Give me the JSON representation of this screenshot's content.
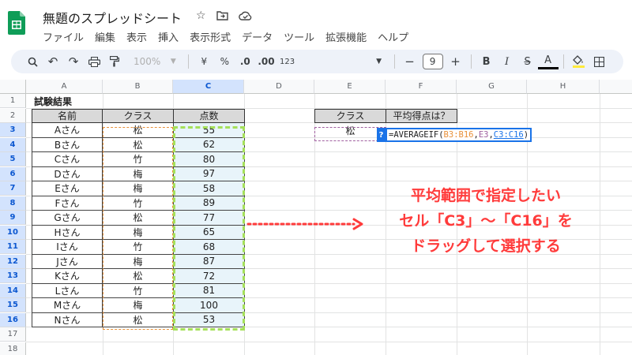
{
  "title_bar": {
    "doc_title": "無題のスプレッドシート",
    "menu": [
      "ファイル",
      "編集",
      "表示",
      "挿入",
      "表示形式",
      "データ",
      "ツール",
      "拡張機能",
      "ヘルプ"
    ]
  },
  "toolbar": {
    "zoom": "100%",
    "currency": "¥",
    "percent": "%",
    "decimal_decrease": ".0",
    "decimal_increase": ".00",
    "number_format": "123",
    "font_size": "9",
    "minus": "−",
    "plus": "+",
    "bold": "B",
    "italic": "I",
    "strike": "S",
    "text_color": "A"
  },
  "columns": [
    "A",
    "B",
    "C",
    "D",
    "E",
    "F",
    "G",
    "H"
  ],
  "rows": [
    "1",
    "2",
    "3",
    "4",
    "5",
    "6",
    "7",
    "8",
    "9",
    "10",
    "11",
    "12",
    "13",
    "14",
    "15",
    "16",
    "17",
    "18"
  ],
  "sheet": {
    "title": "試験結果",
    "headers": {
      "name": "名前",
      "class": "クラス",
      "score": "点数"
    },
    "records": [
      {
        "name": "Aさん",
        "class": "松",
        "score": "55"
      },
      {
        "name": "Bさん",
        "class": "松",
        "score": "62"
      },
      {
        "name": "Cさん",
        "class": "竹",
        "score": "80"
      },
      {
        "name": "Dさん",
        "class": "梅",
        "score": "97"
      },
      {
        "name": "Eさん",
        "class": "梅",
        "score": "58"
      },
      {
        "name": "Fさん",
        "class": "竹",
        "score": "89"
      },
      {
        "name": "Gさん",
        "class": "松",
        "score": "77"
      },
      {
        "name": "Hさん",
        "class": "梅",
        "score": "65"
      },
      {
        "name": "Iさん",
        "class": "竹",
        "score": "68"
      },
      {
        "name": "Jさん",
        "class": "梅",
        "score": "87"
      },
      {
        "name": "Kさん",
        "class": "松",
        "score": "72"
      },
      {
        "name": "Lさん",
        "class": "竹",
        "score": "81"
      },
      {
        "name": "Mさん",
        "class": "梅",
        "score": "100"
      },
      {
        "name": "Nさん",
        "class": "松",
        "score": "53"
      }
    ],
    "side_headers": {
      "class": "クラス",
      "average": "平均得点は？"
    },
    "side_class_value": "松",
    "formula": {
      "prefix": "=AVERAGEIF(",
      "range": "B3:B16",
      "sep1": ",",
      "criteria": "E3",
      "sep2": ",",
      "avg_range": "C3:C16",
      "suffix": ")"
    },
    "help_label": "?"
  },
  "annotation": {
    "line1": "平均範囲で指定したい",
    "line2": "セル「C3」～「C16」を",
    "line3": "ドラッグして選択する"
  },
  "colors": {
    "annotation": "#ff3b3b",
    "range_b": "#e8913a",
    "range_c": "#a5e05a",
    "range_e": "#a060a0",
    "accent": "#1a73e8"
  }
}
